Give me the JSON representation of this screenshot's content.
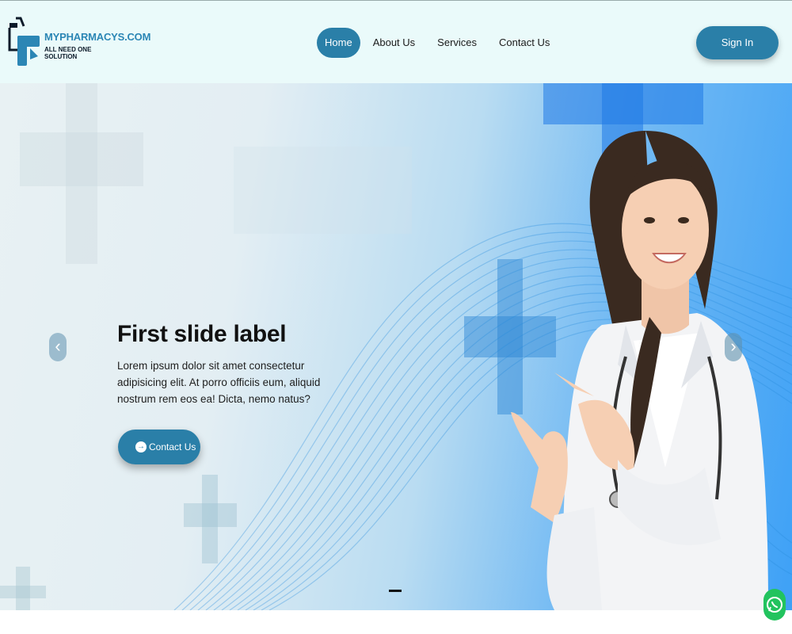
{
  "brand": {
    "name": "MYPHARMACYS.COM",
    "tagline": "ALL NEED ONE SOLUTION",
    "logo_icon": "pharmacy-logo-icon"
  },
  "nav": {
    "items": [
      {
        "label": "Home",
        "active": true
      },
      {
        "label": "About Us",
        "active": false
      },
      {
        "label": "Services",
        "active": false
      },
      {
        "label": "Contact Us",
        "active": false
      }
    ],
    "signin_label": "Sign In"
  },
  "hero": {
    "title": "First slide label",
    "text": "Lorem ipsum dolor sit amet consectetur adipisicing elit. At porro officiis eum, aliquid nostrum rem eos ea! Dicta, nemo natus?",
    "button_label": "Contact Us",
    "button_icon": "arrow-circle-right-icon",
    "prev_icon": "chevron-left-icon",
    "next_icon": "chevron-right-icon",
    "image": "doctor-pointing-image"
  },
  "colors": {
    "accent": "#2a7fa8",
    "header_bg": "#eafafa",
    "brand_text": "#2b86b5",
    "whatsapp": "#22c35e"
  },
  "floating": {
    "whatsapp_icon": "whatsapp-icon"
  }
}
